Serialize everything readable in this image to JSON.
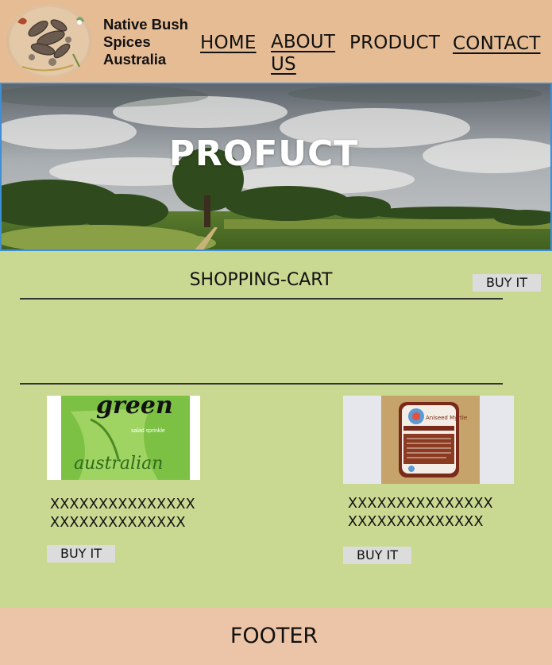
{
  "brand": {
    "name_line1": "Native Bush",
    "name_line2": "Spices",
    "name_line3": "Australia",
    "logo_icon": "spice-pods-logo"
  },
  "nav": {
    "home": "HOME",
    "about_line1": "ABOUT",
    "about_line2": "US",
    "product": "PRODUCT",
    "contact": "CONTACT"
  },
  "hero": {
    "title": "PROFUCT"
  },
  "cart": {
    "heading": "SHOPPING-CART",
    "buy_label": "BUY IT"
  },
  "products": [
    {
      "image_text_1": "green",
      "image_text_2": "salad sprinkle",
      "image_text_3": "australian",
      "line1": "XXXXXXXXXXXXXXX",
      "line2": "XXXXXXXXXXXXXX",
      "buy_label": "BUY IT"
    },
    {
      "image_label": "Aniseed Myrtle",
      "line1": "XXXXXXXXXXXXXXX",
      "line2": "XXXXXXXXXXXXXX",
      "buy_label": "BUY IT"
    }
  ],
  "footer": {
    "text": "FOOTER"
  },
  "colors": {
    "header_bg": "#e6bc95",
    "main_bg": "#c9d992",
    "footer_bg": "#ecc4a7",
    "button_bg": "#dcdcdc",
    "hero_border": "#3f8fd6"
  }
}
